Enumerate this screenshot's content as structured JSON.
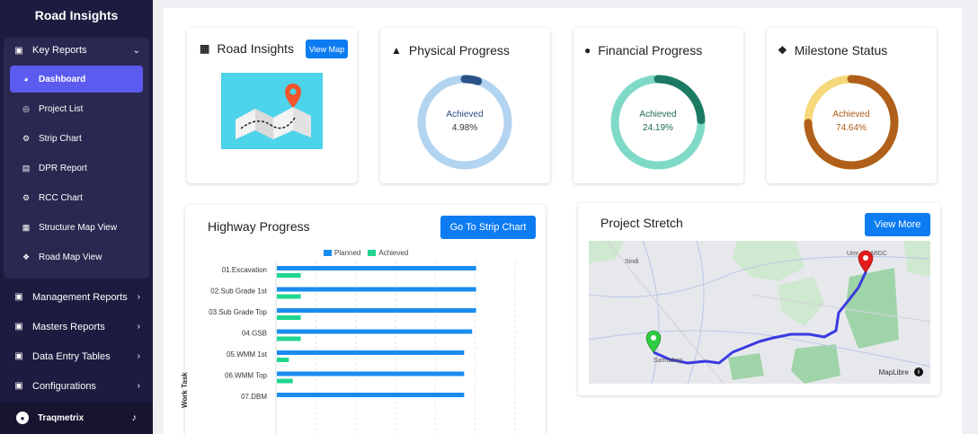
{
  "sidebar": {
    "brand": "Road Insights",
    "key_reports": {
      "label": "Key Reports",
      "items": [
        {
          "label": "Dashboard",
          "icon": "dashboard-icon"
        },
        {
          "label": "Project List",
          "icon": "globe-icon"
        },
        {
          "label": "Strip Chart",
          "icon": "gear-icon"
        },
        {
          "label": "DPR Report",
          "icon": "chart-icon"
        },
        {
          "label": "RCC Chart",
          "icon": "gear-icon"
        },
        {
          "label": "Structure Map View",
          "icon": "map-icon"
        },
        {
          "label": "Road Map View",
          "icon": "signpost-icon"
        }
      ]
    },
    "nav": [
      {
        "label": "Management Reports"
      },
      {
        "label": "Masters Reports"
      },
      {
        "label": "Data Entry Tables"
      },
      {
        "label": "Configurations"
      }
    ],
    "footer": {
      "user": "Traqmetrix"
    }
  },
  "cards": {
    "road_insights": {
      "title": "Road Insights",
      "button": "View Map"
    },
    "physical": {
      "title": "Physical Progress",
      "label": "Achieved",
      "value": "4.98%",
      "percent": 4.98,
      "track": "#b3d4f0",
      "fill": "#2b5288",
      "text_color": "#2b4c7e"
    },
    "financial": {
      "title": "Financial Progress",
      "label": "Achieved",
      "value": "24.19%",
      "percent": 24.19,
      "track": "#7fd9c7",
      "fill": "#1c7a63",
      "text_color": "#1c6b57"
    },
    "milestone": {
      "title": "Milestone Status",
      "label": "Achieved",
      "value": "74.64%",
      "percent": 74.64,
      "track": "#f5d97a",
      "fill": "#b0601a",
      "text_color": "#a85a16"
    }
  },
  "highway": {
    "title": "Highway Progress",
    "button": "Go To Strip Chart",
    "y_axis_label": "Work Task"
  },
  "chart_data": {
    "type": "bar",
    "orientation": "horizontal",
    "categories": [
      "01.Excavation",
      "02.Sub Grade 1st",
      "03.Sub Grade Top",
      "04.GSB",
      "05.WMM 1st",
      "06.WMM Top",
      "07.DBM"
    ],
    "series": [
      {
        "name": "Planned",
        "color": "#1a8cf0",
        "values": [
          100,
          100,
          100,
          98,
          94,
          94,
          94
        ]
      },
      {
        "name": "Achieved",
        "color": "#1fd68f",
        "values": [
          12,
          12,
          12,
          12,
          6,
          8,
          0
        ]
      }
    ],
    "xlim": [
      0,
      120
    ],
    "grid": true,
    "legend": "top"
  },
  "stretch": {
    "title": "Project Stretch",
    "button": "View More",
    "places": {
      "sindi": "Sindi",
      "umrer": "Umr",
      "midc": "MIDC",
      "samudrapur": "Samudrap"
    },
    "attribution": "MapLibre",
    "info": "i"
  }
}
